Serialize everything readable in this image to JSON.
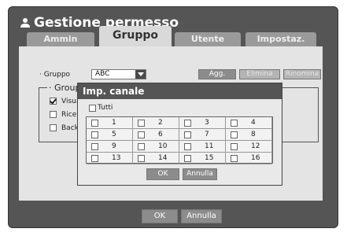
{
  "window": {
    "title": "Gestione permesso"
  },
  "tabs": [
    "Ammin",
    "Gruppo",
    "Utente",
    "Impostaz."
  ],
  "group": {
    "label": "· Gruppo",
    "selected": "ABC",
    "buttons": {
      "add": "Agg.",
      "delete": "Elimina",
      "rename": "Rinomina"
    }
  },
  "group_permissions": {
    "title": "· Group",
    "items": [
      {
        "label": "Visua",
        "checked": true
      },
      {
        "label": "Ricer",
        "checked": false
      },
      {
        "label": "Backu",
        "checked": false
      }
    ]
  },
  "dialog": {
    "title": "Imp. canale",
    "all_label": "Tutti",
    "channels": [
      "1",
      "2",
      "3",
      "4",
      "5",
      "6",
      "7",
      "8",
      "9",
      "10",
      "11",
      "12",
      "13",
      "14",
      "15",
      "16"
    ],
    "ok": "OK",
    "cancel": "Annulla"
  },
  "footer": {
    "ok": "OK",
    "cancel": "Annulla"
  },
  "colors": {
    "window_bg": "#555555",
    "content_bg": "#e4e4e4",
    "tab_active": "#d9d9d9",
    "tab_inactive": "#9a9a9a",
    "button": "#8c8c8c"
  }
}
